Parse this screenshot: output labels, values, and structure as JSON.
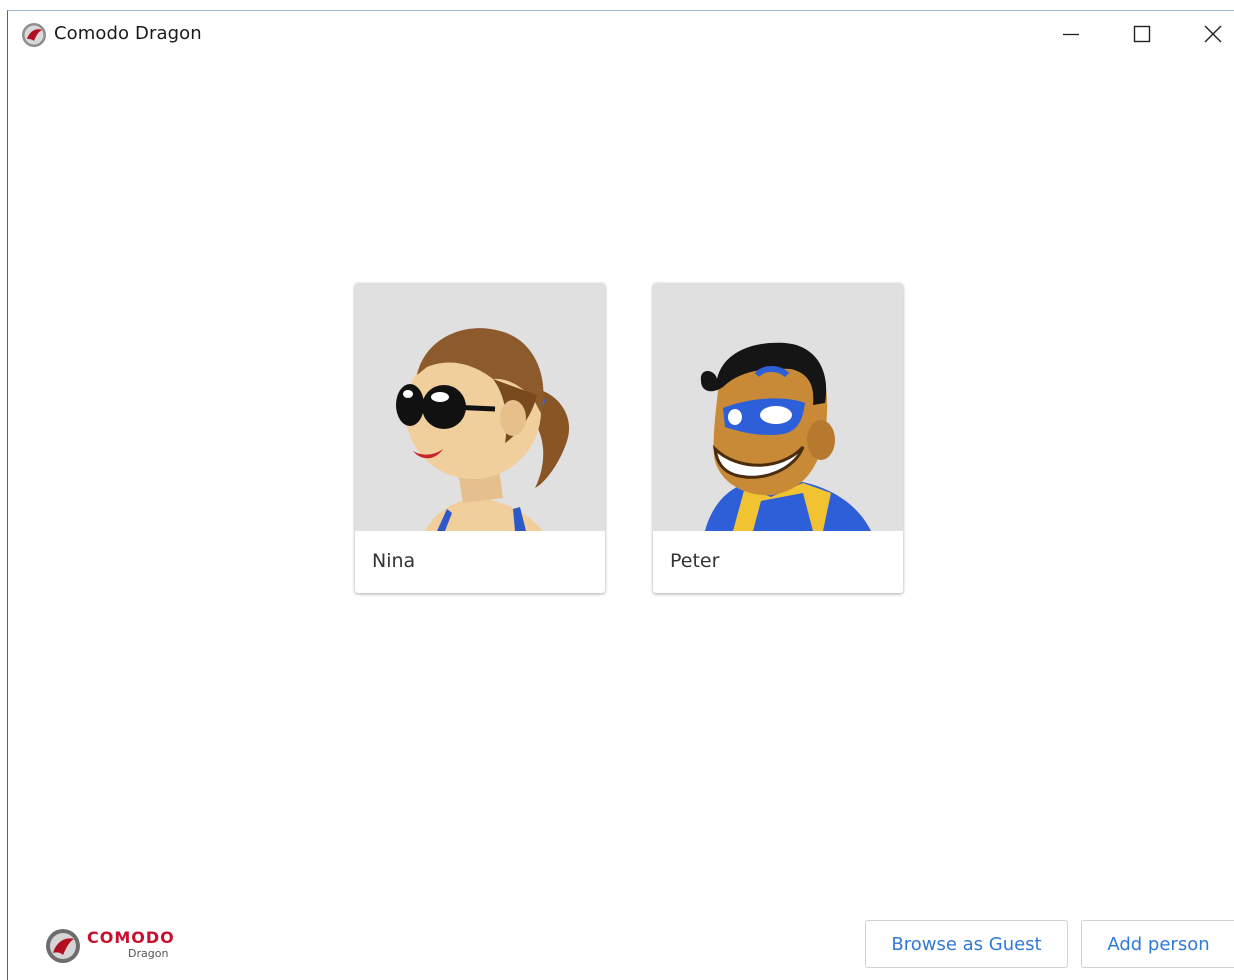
{
  "window": {
    "title": "Comodo Dragon"
  },
  "controls": {
    "minimize": "minimize-icon",
    "maximize": "maximize-icon",
    "close": "close-icon"
  },
  "profiles": [
    {
      "name": "Nina",
      "avatar": "woman-sunglasses-avatar"
    },
    {
      "name": "Peter",
      "avatar": "masked-hero-avatar"
    }
  ],
  "footer": {
    "logo_text": "COMODO",
    "logo_sub": "Dragon",
    "browse_guest_label": "Browse as Guest",
    "add_person_label": "Add person"
  },
  "colors": {
    "accent": "#2f7ad8",
    "brand": "#c8102e",
    "card_bg": "#e0e0e0"
  }
}
